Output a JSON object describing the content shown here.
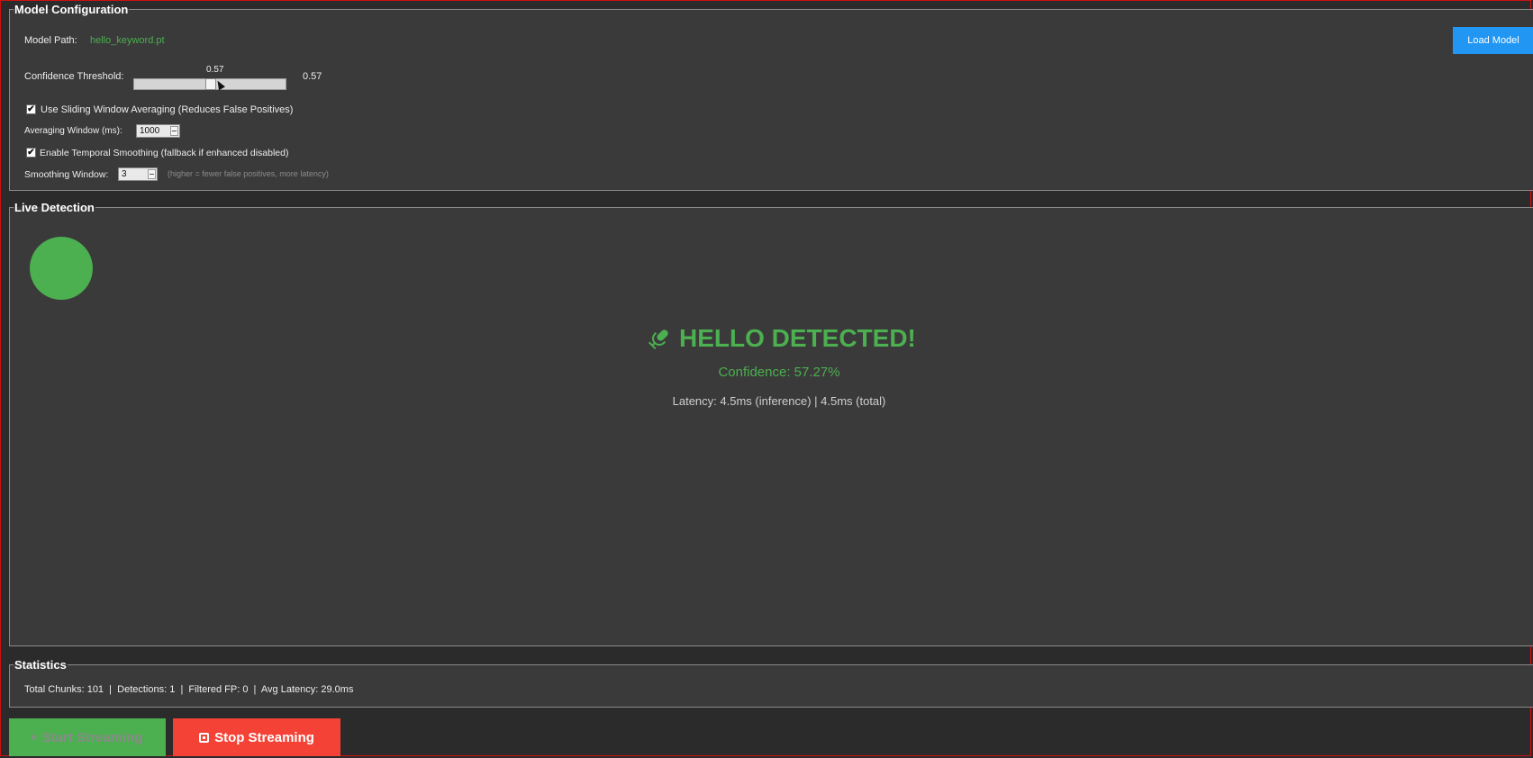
{
  "model_config": {
    "title": "Model Configuration",
    "model_path_label": "Model Path:",
    "model_path_value": "hello_keyword.pt",
    "load_button": "Load Model",
    "threshold_label": "Confidence Threshold:",
    "threshold_tick": "0.57",
    "threshold_value": "0.57",
    "threshold_level": 0.57,
    "sliding_window_checked": true,
    "sliding_window_label": "Use Sliding Window Averaging (Reduces False Positives)",
    "averaging_window_label": "Averaging Window (ms):",
    "averaging_window_value": "1000",
    "temporal_smoothing_checked": true,
    "temporal_smoothing_label": "Enable Temporal Smoothing (fallback if enhanced disabled)",
    "smoothing_window_label": "Smoothing Window:",
    "smoothing_window_value": "3",
    "smoothing_hint": "(higher = fewer false positives, more latency)"
  },
  "live_detection": {
    "title": "Live Detection",
    "indicator_color": "#4caf50",
    "icon": "microphone-icon",
    "headline": "HELLO DETECTED!",
    "confidence": "Confidence: 57.27%",
    "latency": "Latency: 4.5ms (inference) | 4.5ms (total)"
  },
  "statistics": {
    "title": "Statistics",
    "summary": "Total Chunks: 101  |  Detections: 1  |  Filtered FP: 0  |  Avg Latency: 29.0ms"
  },
  "controls": {
    "start_label": "Start Streaming",
    "stop_label": "Stop Streaming"
  },
  "colors": {
    "accent_green": "#4caf50",
    "accent_blue": "#2196f3",
    "accent_red": "#f44336"
  }
}
